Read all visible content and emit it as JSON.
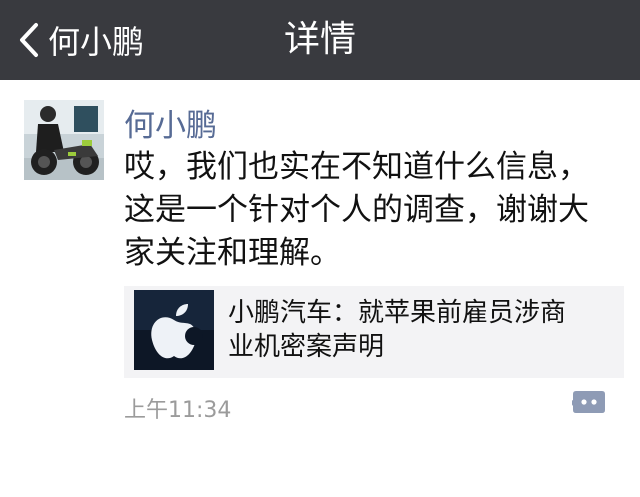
{
  "header": {
    "back_label": "何小鹏",
    "title": "详情"
  },
  "post": {
    "author": "何小鹏",
    "text_lines": [
      "哎，我们也实在不知道什么信息，",
      "这是一个针对个人的调查，谢谢大",
      "家关注和理解。"
    ],
    "link": {
      "title_lines": [
        "小鹏汽车：就苹果前雇员涉商",
        "业机密案声明"
      ]
    },
    "time": "上午11:34"
  },
  "icons": {
    "back": "chevron-left-icon",
    "comment": "comment-bubble-icon"
  },
  "colors": {
    "navbar_bg": "#393a3f",
    "author_name": "#576b95",
    "link_card_bg": "#f3f3f5",
    "time_text": "#9b9b9b",
    "comment_icon": "#8e9bb5"
  }
}
